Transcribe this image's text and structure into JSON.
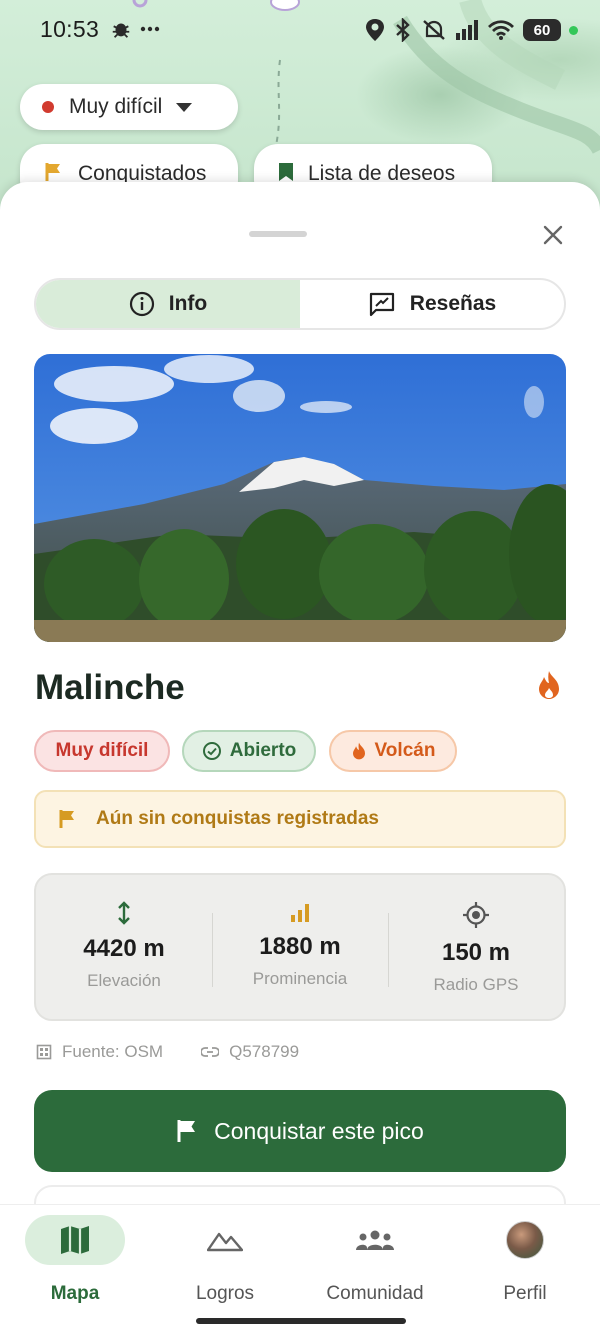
{
  "status_bar": {
    "time": "10:53",
    "battery": "60"
  },
  "map_filters": {
    "difficulty": "Muy difícil",
    "conquered": "Conquistados",
    "wishlist": "Lista de deseos"
  },
  "tabs": [
    {
      "label": "Info",
      "active": true
    },
    {
      "label": "Reseñas",
      "active": false
    }
  ],
  "peak": {
    "name": "Malinche",
    "tags": {
      "difficulty": "Muy difícil",
      "status": "Abierto",
      "type": "Volcán"
    },
    "banner": "Aún sin conquistas registradas",
    "stats": [
      {
        "value": "4420 m",
        "label": "Elevación",
        "icon": "elevation-arrows-icon"
      },
      {
        "value": "1880 m",
        "label": "Prominencia",
        "icon": "bar-chart-icon"
      },
      {
        "value": "150 m",
        "label": "Radio GPS",
        "icon": "gps-target-icon"
      }
    ],
    "source": "Fuente: OSM",
    "wikidata": "Q578799"
  },
  "cta": {
    "label": "Conquistar este pico"
  },
  "nav": [
    {
      "label": "Mapa",
      "active": true
    },
    {
      "label": "Logros",
      "active": false
    },
    {
      "label": "Comunidad",
      "active": false
    },
    {
      "label": "Perfil",
      "active": false
    }
  ],
  "colors": {
    "primary": "#2c6b3b",
    "danger": "#c7372e",
    "warning": "#b07a16",
    "accent_orange": "#d45a1a"
  }
}
